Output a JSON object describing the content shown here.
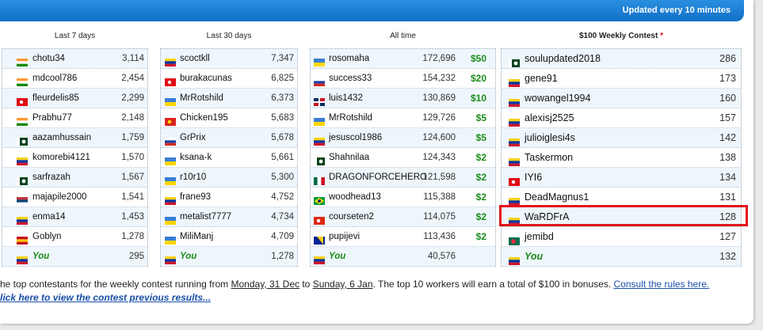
{
  "banner": "Updated every 10 minutes",
  "columns": [
    {
      "title": "Last 7 days",
      "rows": [
        {
          "flag": "in",
          "name": "chotu34",
          "value": "3,114"
        },
        {
          "flag": "in",
          "name": "mdcool786",
          "value": "2,454"
        },
        {
          "flag": "tr",
          "name": "fleurdelis85",
          "value": "2,299"
        },
        {
          "flag": "in",
          "name": "Prabhu77",
          "value": "2,148"
        },
        {
          "flag": "pk",
          "name": "aazamhussain",
          "value": "1,759"
        },
        {
          "flag": "ve",
          "name": "komorebi4121",
          "value": "1,570"
        },
        {
          "flag": "pk",
          "name": "sarfrazah",
          "value": "1,567"
        },
        {
          "flag": "rs",
          "name": "majapile2000",
          "value": "1,541"
        },
        {
          "flag": "ve",
          "name": "enma14",
          "value": "1,453"
        },
        {
          "flag": "es",
          "name": "Goblyn",
          "value": "1,278"
        },
        {
          "flag": "ve",
          "name": "You",
          "value": "295",
          "you": true
        }
      ]
    },
    {
      "title": "Last 30 days",
      "rows": [
        {
          "flag": "ve",
          "name": "scoctkll",
          "value": "7,347"
        },
        {
          "flag": "tr",
          "name": "burakacunas",
          "value": "6,825"
        },
        {
          "flag": "ua",
          "name": "MrRotshild",
          "value": "6,373"
        },
        {
          "flag": "vn",
          "name": "Chicken195",
          "value": "5,683"
        },
        {
          "flag": "ru",
          "name": "GrPrix",
          "value": "5,678"
        },
        {
          "flag": "ua",
          "name": "ksana-k",
          "value": "5,661"
        },
        {
          "flag": "ua",
          "name": "r10r10",
          "value": "5,300"
        },
        {
          "flag": "ve",
          "name": "frane93",
          "value": "4,752"
        },
        {
          "flag": "ua",
          "name": "metalist7777",
          "value": "4,734"
        },
        {
          "flag": "ua",
          "name": "MiliManj",
          "value": "4,709"
        },
        {
          "flag": "ve",
          "name": "You",
          "value": "1,278",
          "you": true
        }
      ]
    },
    {
      "title": "All time",
      "rows": [
        {
          "flag": "ua",
          "name": "rosomaha",
          "value": "172,696",
          "prize": "$50"
        },
        {
          "flag": "ru",
          "name": "success33",
          "value": "154,232",
          "prize": "$20"
        },
        {
          "flag": "do",
          "name": "luis1432",
          "value": "130,869",
          "prize": "$10"
        },
        {
          "flag": "ua",
          "name": "MrRotshild",
          "value": "129,726",
          "prize": "$5"
        },
        {
          "flag": "ve",
          "name": "jesuscol1986",
          "value": "124,600",
          "prize": "$5"
        },
        {
          "flag": "pk",
          "name": "Shahnilaa",
          "value": "124,343",
          "prize": "$2"
        },
        {
          "flag": "mx",
          "name": "DRAGONFORCEHERO",
          "value": "121,598",
          "prize": "$2"
        },
        {
          "flag": "br",
          "name": "woodhead13",
          "value": "115,388",
          "prize": "$2"
        },
        {
          "flag": "hk",
          "name": "courseten2",
          "value": "114,075",
          "prize": "$2"
        },
        {
          "flag": "ba",
          "name": "pupijevi",
          "value": "113,436",
          "prize": "$2"
        },
        {
          "flag": "ve",
          "name": "You",
          "value": "40,576",
          "you": true
        }
      ]
    },
    {
      "title": "$100 Weekly Contest",
      "star": "*",
      "rows": [
        {
          "flag": "pk",
          "name": "soulupdated2018",
          "value": "286"
        },
        {
          "flag": "ve",
          "name": "gene91",
          "value": "173"
        },
        {
          "flag": "ve",
          "name": "wowangel1994",
          "value": "160"
        },
        {
          "flag": "ve",
          "name": "alexisj2525",
          "value": "157"
        },
        {
          "flag": "ve",
          "name": "julioiglesi4s",
          "value": "142"
        },
        {
          "flag": "ve",
          "name": "Taskermon",
          "value": "138"
        },
        {
          "flag": "tr",
          "name": "IYI6",
          "value": "134"
        },
        {
          "flag": "ve",
          "name": "DeadMagnus1",
          "value": "131"
        },
        {
          "flag": "ve",
          "name": "WaRDFrA",
          "value": "128"
        },
        {
          "flag": "bd",
          "name": "jemibd",
          "value": "127"
        },
        {
          "flag": "ve",
          "name": "You",
          "value": "132",
          "you": true
        }
      ]
    }
  ],
  "footer": {
    "line1_a": "he top contestants for the weekly contest running from ",
    "start_date": "Monday, 31 Dec",
    "to": " to ",
    "end_date": "Sunday, 6 Jan",
    "line1_b": ". The top 10 workers will earn a total of $100 in bonuses. ",
    "rules_link": "Consult the rules here.",
    "previous_link": "lick here to view the contest previous results..."
  },
  "flag_colors": {
    "ve": [
      "#f7d116",
      "#0033a0",
      "#cf142b"
    ],
    "ua": [
      "#3a7dd4",
      "#ffd500"
    ],
    "in": [
      "#ff9933",
      "#ffffff",
      "#138808"
    ],
    "ru": [
      "#ffffff",
      "#1c3fa8",
      "#d52b1e"
    ],
    "tr": [
      "#e30a17"
    ],
    "pk": [
      "#ffffff",
      "#01411c"
    ],
    "vn": [
      "#da251d"
    ],
    "rs": [
      "#c6363c",
      "#0c4076",
      "#ffffff"
    ],
    "es": [
      "#c60b1e",
      "#ffc400",
      "#c60b1e"
    ],
    "mx": [
      "#006847",
      "#ffffff",
      "#ce1126"
    ],
    "br": [
      "#009c3b",
      "#ffdf00"
    ],
    "hk": [
      "#de2910"
    ],
    "ba": [
      "#002395",
      "#fecb00"
    ],
    "do": [
      "#002d62",
      "#ce1126"
    ],
    "bd": [
      "#006a4e",
      "#f42a41"
    ]
  }
}
